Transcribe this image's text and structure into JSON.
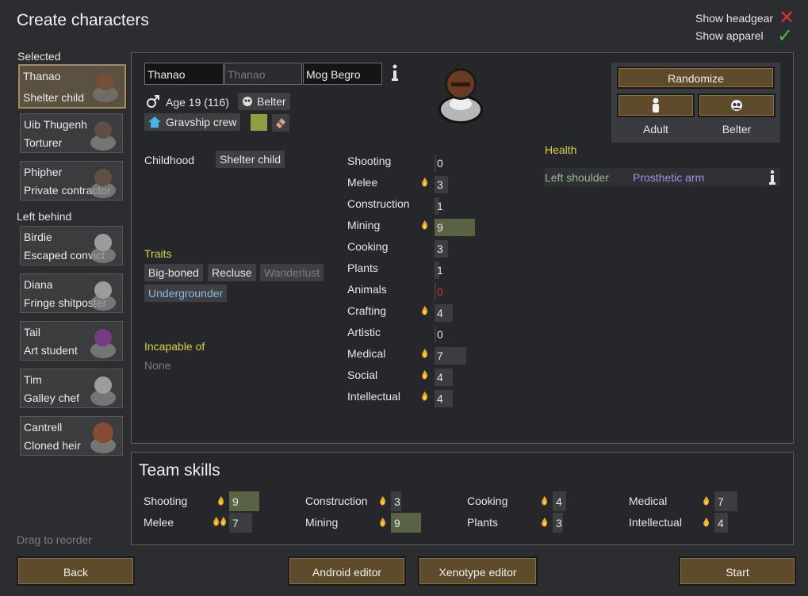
{
  "title": "Create characters",
  "toggles": {
    "headgear": "Show headgear",
    "apparel": "Show apparel"
  },
  "sidebar": {
    "selected_label": "Selected",
    "left_behind_label": "Left behind",
    "drag_hint": "Drag to reorder",
    "selected": [
      {
        "name": "Thanao",
        "title": "Shelter child"
      },
      {
        "name": "Uib Thugenh",
        "title": "Torturer"
      },
      {
        "name": "Phipher",
        "title": "Private contractor"
      }
    ],
    "left_behind": [
      {
        "name": "Birdie",
        "title": "Escaped convict"
      },
      {
        "name": "Diana",
        "title": "Fringe shitposter"
      },
      {
        "name": "Tail",
        "title": "Art student"
      },
      {
        "name": "Tim",
        "title": "Galley chef"
      },
      {
        "name": "Cantrell",
        "title": "Cloned heir"
      }
    ]
  },
  "pawn": {
    "first_name": "Thanao",
    "nick_placeholder": "Thanao",
    "last_name": "Mog Begro",
    "age": "Age 19 (116)",
    "xenotype": "Belter",
    "faction": "Gravship crew",
    "childhood_label": "Childhood",
    "childhood": "Shelter child",
    "traits_label": "Traits",
    "traits": [
      "Big-boned",
      "Recluse",
      "Wanderlust",
      "Undergrounder"
    ],
    "incapable_label": "Incapable of",
    "incapable": "None"
  },
  "controls": {
    "randomize": "Randomize",
    "adult": "Adult",
    "belter": "Belter"
  },
  "health": {
    "label": "Health",
    "part": "Left shoulder",
    "condition": "Prosthetic arm"
  },
  "skills": [
    {
      "name": "Shooting",
      "value": "0",
      "level": 0,
      "passion": false
    },
    {
      "name": "Melee",
      "value": "3",
      "level": 3,
      "passion": true
    },
    {
      "name": "Construction",
      "value": "1",
      "level": 1,
      "passion": false
    },
    {
      "name": "Mining",
      "value": "9",
      "level": 9,
      "passion": true
    },
    {
      "name": "Cooking",
      "value": "3",
      "level": 3,
      "passion": false
    },
    {
      "name": "Plants",
      "value": "1",
      "level": 1,
      "passion": false
    },
    {
      "name": "Animals",
      "value": "0",
      "level": 0,
      "passion": false
    },
    {
      "name": "Crafting",
      "value": "4",
      "level": 4,
      "passion": true
    },
    {
      "name": "Artistic",
      "value": "0",
      "level": 0,
      "passion": false
    },
    {
      "name": "Medical",
      "value": "7",
      "level": 7,
      "passion": true
    },
    {
      "name": "Social",
      "value": "4",
      "level": 4,
      "passion": true
    },
    {
      "name": "Intellectual",
      "value": "4",
      "level": 4,
      "passion": true
    }
  ],
  "team": {
    "title": "Team skills",
    "skills": [
      {
        "name": "Shooting",
        "value": "9"
      },
      {
        "name": "Construction",
        "value": "3"
      },
      {
        "name": "Cooking",
        "value": "4"
      },
      {
        "name": "Medical",
        "value": "7"
      },
      {
        "name": "Melee",
        "value": "7"
      },
      {
        "name": "Mining",
        "value": "9"
      },
      {
        "name": "Plants",
        "value": "3"
      },
      {
        "name": "Intellectual",
        "value": "4"
      }
    ]
  },
  "footer": {
    "back": "Back",
    "android_editor": "Android editor",
    "xenotype_editor": "Xenotype editor",
    "start": "Start"
  }
}
